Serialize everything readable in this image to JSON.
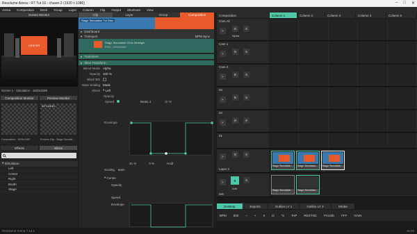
{
  "window": {
    "title": "Resolume Arena - R7 Tut 10 - chaser 2 (1920 x 1080)",
    "controls": [
      "–",
      "□",
      "✕"
    ]
  },
  "menu": [
    "Arena",
    "Composition",
    "Deck",
    "Group",
    "Layer",
    "Column",
    "Clip",
    "Output",
    "Shortcuts",
    "View"
  ],
  "screen_monitor": {
    "title": "Screen Monitor",
    "center_label": "CENTER",
    "screen_label": "Screen 1 - Simulation - 1920x1080",
    "buttons": [
      "Composition Monitor",
      "Preview Monitor"
    ],
    "thumb_left_label": "Composition - 1920x1080",
    "thumb_right_label": "Preview Clip - Stage Simulati...",
    "thumb_right_overlay": "A Fr 1.8:12",
    "tabs": [
      "Effects",
      "Slices"
    ],
    "tree_root": "Simulation",
    "tree_items": [
      "Left",
      "Center",
      "Right",
      "Booth",
      "Stage"
    ]
  },
  "clip_panel": {
    "tabs": [
      "Clip",
      "Layer",
      "Group",
      "Composition"
    ],
    "clip_name": "Stage Simulation Tut Wax",
    "dashboard": "Dashboard",
    "transport": "Transport",
    "bpm_sync": "BPM Sync",
    "clip_info_line1": "Stage Simulation Chris Weblight",
    "clip_info_line2": "PNG, 1920x1080",
    "transform": "Transform",
    "slice_transform": "Slice Transform",
    "blend_mode_label": "Blend Mode",
    "blend_mode_value": "Alpha",
    "opacity_label": "Opacity",
    "opacity_value": "100 %",
    "black_bg_label": "Black BG",
    "main_scaling_label": "Main Scaling",
    "main_scaling_value": "Mask",
    "slices_label": "Slices",
    "slice_left": "Left",
    "slice_center": "Center",
    "opacity_row": "Opacity",
    "speed_row": "Speed",
    "envelope_row": "Envelope",
    "beats_label": "Beats",
    "beats_value": "4",
    "pos_value": "41 %",
    "pos_value2": "0 %",
    "hold_label": "Hold",
    "scaling_label": "Scaling",
    "scaling_value": "Main",
    "divide": "/2",
    "multiply": "*2"
  },
  "composition": {
    "columns": [
      "Column 1",
      "Column 2",
      "Column 3",
      "Column 4",
      "Column 5"
    ],
    "composition_label": "Composition",
    "layers": [
      {
        "name": "Cam All",
        "sub": "Alpha"
      },
      {
        "name": "Cam 1",
        "sub": ""
      },
      {
        "name": "Cam 2",
        "sub": ""
      },
      {
        "name": "03",
        "sub": ""
      },
      {
        "name": "02",
        "sub": ""
      },
      {
        "name": "01",
        "sub": ""
      },
      {
        "name": "Layer 2",
        "sub": "Alpha"
      },
      {
        "name": "Set",
        "sub": "Add"
      }
    ],
    "clip_captions": [
      "Stage Simulation...",
      "Stage Simulation...",
      "Stage Simulation...",
      "Stage Simulation...",
      "Stage Simulation..."
    ],
    "bottom_tabs": [
      "Desktop",
      "Exports",
      "Outline LV 1",
      "Outline LV 2",
      "Strobe"
    ],
    "transport": {
      "bpm_label": "BPM",
      "bpm_value": "500",
      "buttons": [
        "–",
        "+",
        "II",
        "/2",
        "*2",
        "TAP",
        "RESYNC",
        "PAUSE"
      ],
      "fff_label": "FFF",
      "gain_label": "GAIN"
    }
  },
  "status": {
    "left": "Resolume Arena 7.13.1",
    "right": "18:20"
  },
  "colors": {
    "accent": "#4ec8a8",
    "orange": "#e85a2a",
    "blue": "#3a78b0"
  }
}
